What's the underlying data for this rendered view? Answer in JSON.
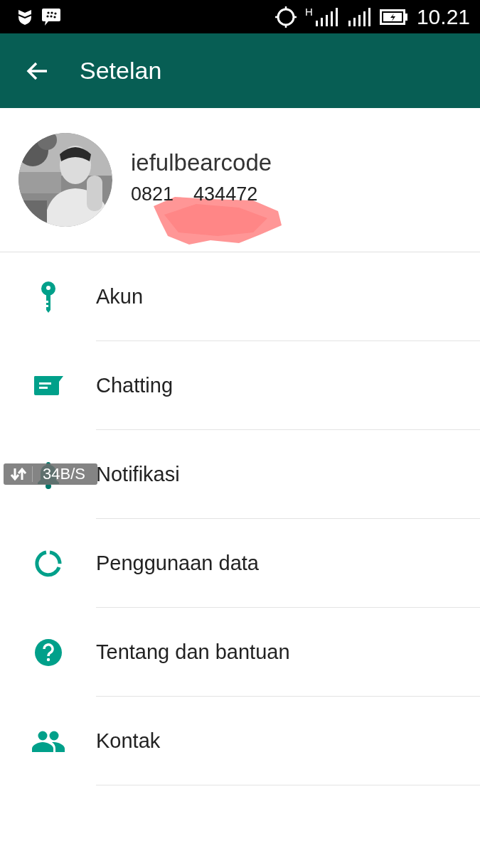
{
  "status_bar": {
    "time": "10.21",
    "network_label": "H"
  },
  "app_bar": {
    "title": "Setelan"
  },
  "profile": {
    "name": "iefulbearcode",
    "phone_parts": [
      "0821",
      "434472"
    ],
    "redacted": true
  },
  "menu": [
    {
      "kind": "key",
      "label": "Akun"
    },
    {
      "kind": "chat",
      "label": "Chatting"
    },
    {
      "kind": "bell",
      "label": "Notifikasi"
    },
    {
      "kind": "data",
      "label": "Penggunaan data"
    },
    {
      "kind": "help",
      "label": "Tentang dan bantuan"
    },
    {
      "kind": "contacts",
      "label": "Kontak"
    }
  ],
  "speed_overlay": {
    "reading": "34B/S"
  }
}
